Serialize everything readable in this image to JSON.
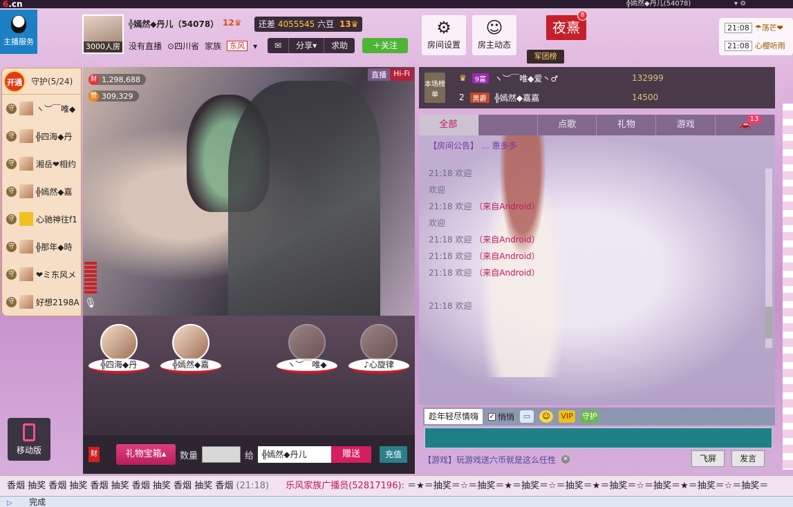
{
  "topbar": {
    "logo_prefix": "6",
    "logo_suffix": ".cn",
    "user": "╬嫣然◆丹儿(54078)",
    "icons": "▾ ⚙"
  },
  "service": {
    "label": "主播服务"
  },
  "anchor": {
    "room_caption": "3000人房",
    "name": "╬嫣然◆丹儿（54078）",
    "level": "12",
    "gap_label": "还差",
    "gap_value": "4055545",
    "gap_unit": "六豆",
    "next_level": "13",
    "status": "没有直播",
    "location": "四川省",
    "family_label": "家族",
    "family_tag": "东风",
    "actions": [
      "✉",
      "分享▾",
      "求助"
    ],
    "follow": "＋关注"
  },
  "tools": [
    {
      "label": "房间设置",
      "icon": "⚙"
    },
    {
      "label": "房主动态",
      "icon": "☺"
    }
  ],
  "night": {
    "label": "夜熹",
    "badge": "8"
  },
  "army": {
    "label": "军团榜"
  },
  "side_msgs": [
    {
      "time": "21:08",
      "user": "☂荡芒❤"
    },
    {
      "time": "21:08",
      "user": "心樱听雨"
    }
  ],
  "guard": {
    "open": "开通",
    "title": "守护(5/24)",
    "badge": "守",
    "items": [
      "ヽ︶￣唯◆",
      "╬四海◆丹",
      "湘岳❤相约",
      "╬嫣然◆嘉",
      "心驰神往f1",
      "╬那年◆時",
      "❤ミ东风メ",
      "好想2198A"
    ]
  },
  "mobile": {
    "label": "移动版"
  },
  "video": {
    "stat1_icon": "财",
    "stat1": "1,298,688",
    "stat2_icon": "赞",
    "stat2": "309,329",
    "tag_live": "直播",
    "tag_hifi": "Hi-Fi",
    "mic": "🎙"
  },
  "podiums": [
    "╬四海◆丹",
    "╬嫣然◆嘉",
    "ヽ︶￣唯◆",
    "♪心旋律"
  ],
  "giftbar": {
    "icon": "财",
    "box": "礼物宝箱▴",
    "qty_label": "数量",
    "to_label": "给",
    "to_name": "╬嫣然◆丹儿",
    "send": "赠送",
    "recharge": "充值"
  },
  "rank": {
    "tag": "本场榜单",
    "rows": [
      {
        "pos": "♛",
        "badge": "9富",
        "name": "ヽ︶￣唯◆爱丶♂",
        "score": "132999"
      },
      {
        "pos": "2",
        "badge": "男爵",
        "name": "╬嫣然◆嘉嘉",
        "score": "14500"
      }
    ]
  },
  "tabs": [
    "全部",
    "",
    "点歌",
    "礼物",
    "游戏",
    "🚗"
  ],
  "car_badge": "13",
  "chat": {
    "announce": "【房间公告】",
    "announce_text": "惠多多",
    "lines": [
      {
        "time": "21:18",
        "text": "欢迎",
        "src": ""
      },
      {
        "time": "",
        "text": "欢迎",
        "src": ""
      },
      {
        "time": "21:18",
        "text": "欢迎",
        "src": "（来自Android）"
      },
      {
        "time": "",
        "text": "欢迎",
        "src": ""
      },
      {
        "time": "21:18",
        "text": "欢迎",
        "src": "（来自Android）"
      },
      {
        "time": "21:18",
        "text": "欢迎",
        "src": "（来自Android）"
      },
      {
        "time": "21:18",
        "text": "欢迎",
        "src": "（来自Android）"
      },
      {
        "time": "21:18",
        "text": "欢迎",
        "src": ""
      }
    ]
  },
  "chat_tools": {
    "topic": "趁年轻尽情嗨",
    "whisper": "悄悄",
    "check": "✓",
    "vip": "VIP",
    "guard": "守护",
    "emoji": "☺",
    "image": "▭"
  },
  "hint": {
    "text": "【游戏】玩游戏送六币就是这么任性",
    "close": "✕"
  },
  "buttons": {
    "fly": "飞屏",
    "send": "发言"
  },
  "marquee": {
    "left": "香烟 抽奖 香烟 抽奖 香烟 抽奖 香烟 抽奖 香烟 抽奖 香烟",
    "time": "(21:18)",
    "broadcast": "乐风家族广播员(52817196):",
    "right": "＝★＝抽奖＝☆＝抽奖＝★＝抽奖＝☆＝抽奖＝★＝抽奖＝☆＝抽奖＝★＝抽奖＝☆＝抽奖＝"
  },
  "status": {
    "text": "完成"
  }
}
